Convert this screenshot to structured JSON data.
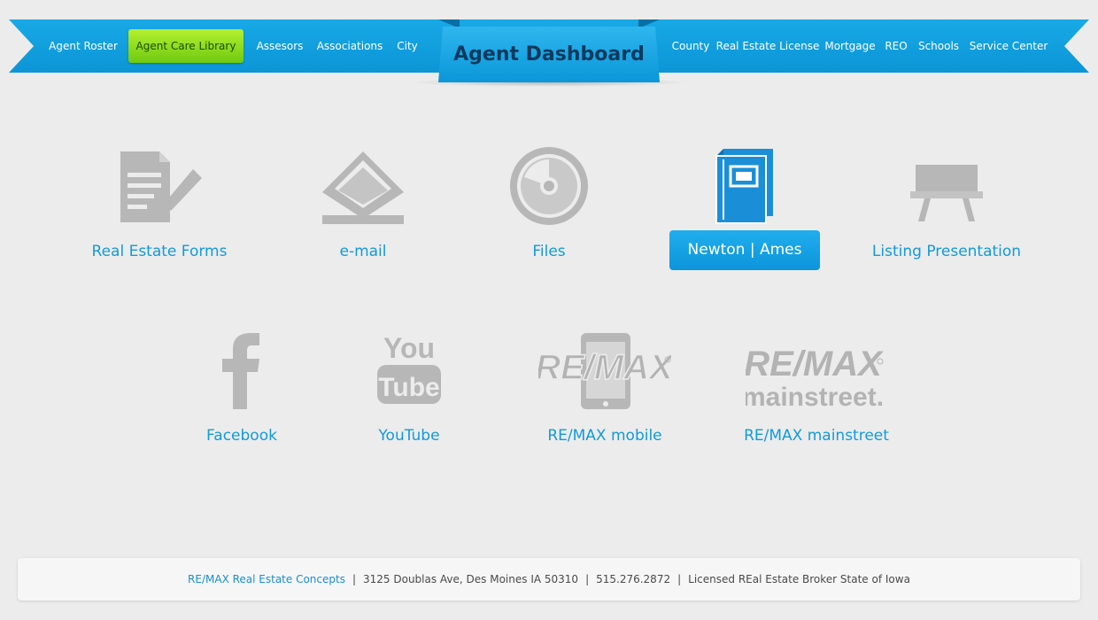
{
  "nav": {
    "items": [
      {
        "label": "Agent Roster"
      },
      {
        "label": "Agent Care Library",
        "active": true
      },
      {
        "label": "Assesors"
      },
      {
        "label": "Associations"
      },
      {
        "label": "City"
      },
      {
        "label": "County"
      },
      {
        "label": "Real Estate License"
      },
      {
        "label": "Mortgage"
      },
      {
        "label": "REO"
      },
      {
        "label": "Schools"
      },
      {
        "label": "Service Center"
      }
    ],
    "dashboard_title": "Agent Dashboard"
  },
  "tiles": [
    {
      "label": "Real Estate Forms",
      "icon": "document-edit-icon"
    },
    {
      "label": "e-mail",
      "icon": "envelope-icon"
    },
    {
      "label": "Files",
      "icon": "disc-icon"
    },
    {
      "label": "Newton | Ames",
      "icon": "book-icon",
      "highlighted": true
    },
    {
      "label": "Listing Presentation",
      "icon": "easel-icon"
    },
    {
      "label": "Facebook",
      "icon": "facebook-icon"
    },
    {
      "label": "YouTube",
      "icon": "youtube-icon",
      "logo_text": [
        "You",
        "Tube"
      ]
    },
    {
      "label": "RE/MAX mobile",
      "icon": "remax-mobile-icon",
      "logo_text": "RE/MAX"
    },
    {
      "label": "RE/MAX mainstreet",
      "icon": "remax-mainstreet-icon",
      "logo_text": [
        "RE/MAX",
        "mainstreet."
      ]
    }
  ],
  "footer": {
    "brand": "RE/MAX Real Estate Concepts",
    "address": "3125 Doublas Ave, Des Moines IA 50310",
    "phone": "515.276.2872",
    "license": "Licensed REal Estate Broker State of Iowa",
    "separator": "|"
  },
  "colors": {
    "ribbon": "#0c95d6",
    "active_nav": "#8fdc1c",
    "link": "#129ad9",
    "icon_gray": "#b7b7b7",
    "icon_active": "#1a8fd8"
  }
}
